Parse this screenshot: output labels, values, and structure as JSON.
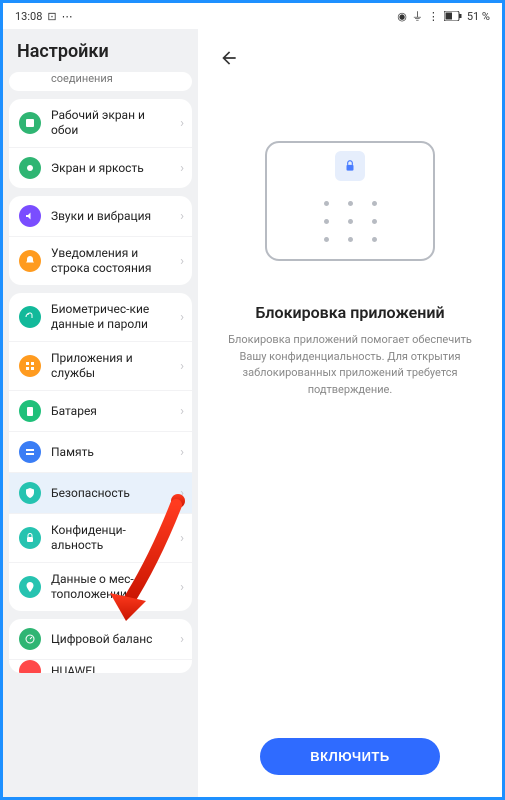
{
  "status": {
    "time": "13:08",
    "battery": "51 %"
  },
  "sidebar": {
    "title": "Настройки",
    "items": [
      {
        "label": "соединения",
        "color": "#3aa2f5",
        "partial": true
      },
      {
        "label": "Рабочий экран и обои",
        "color": "#2fb573"
      },
      {
        "label": "Экран и яркость",
        "color": "#2fb573"
      },
      {
        "label": "Звуки и вибрация",
        "color": "#7a4dff"
      },
      {
        "label": "Уведомления и строка состояния",
        "color": "#ff9b1f"
      },
      {
        "label": "Биометричес-кие данные и пароли",
        "color": "#12b99a"
      },
      {
        "label": "Приложения и службы",
        "color": "#ff9b1f"
      },
      {
        "label": "Батарея",
        "color": "#1fc07a"
      },
      {
        "label": "Память",
        "color": "#3a7df5"
      },
      {
        "label": "Безопасность",
        "color": "#26c3b0",
        "selected": true
      },
      {
        "label": "Конфиденци-альность",
        "color": "#26c3b0"
      },
      {
        "label": "Данные о мес-тоположении",
        "color": "#26c3b0"
      },
      {
        "label": "Цифровой баланс",
        "color": "#2fb573"
      },
      {
        "label": "HUAWEI",
        "color": "#ff4848",
        "cut": true
      }
    ]
  },
  "main": {
    "title": "Блокировка приложений",
    "description": "Блокировка приложений помогает обеспечить Вашу конфиденциальность. Для открытия заблокированных приложений требуется подтверждение.",
    "button": "ВКЛЮЧИТЬ"
  }
}
